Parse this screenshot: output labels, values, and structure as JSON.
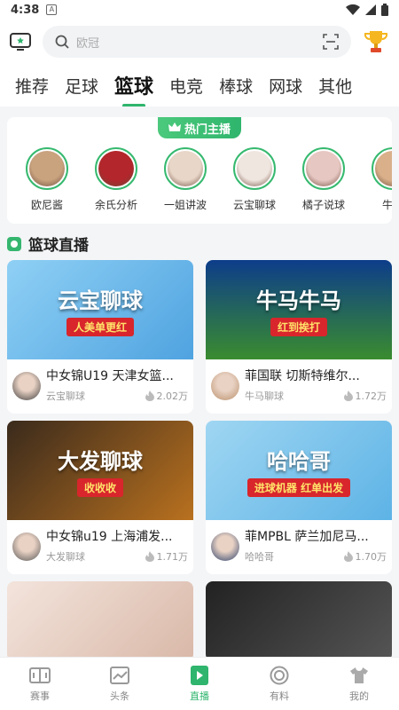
{
  "status": {
    "time": "4:38",
    "notif_letter": "A"
  },
  "search": {
    "placeholder": "欧冠"
  },
  "tabs": [
    {
      "label": "推荐"
    },
    {
      "label": "足球"
    },
    {
      "label": "篮球"
    },
    {
      "label": "电竞"
    },
    {
      "label": "棒球"
    },
    {
      "label": "网球"
    },
    {
      "label": "其他"
    }
  ],
  "active_tab": "篮球",
  "hot": {
    "badge": "热门主播",
    "anchors": [
      {
        "name": "欧尼酱",
        "color": "#c9a27e"
      },
      {
        "name": "余氏分析",
        "color": "#b3262b"
      },
      {
        "name": "一姐讲波",
        "color": "#e8d6c8"
      },
      {
        "name": "云宝聊球",
        "color": "#f0e6e0"
      },
      {
        "name": "橘子说球",
        "color": "#e7c7c2"
      },
      {
        "name": "牛马",
        "color": "#d9b08a"
      }
    ]
  },
  "section": {
    "title": "篮球直播"
  },
  "cards": [
    {
      "title": "中女锦U19 天津女篮...",
      "anchor": "云宝聊球",
      "heat": "2.02万",
      "thumb_text": "云宝聊球",
      "thumb_sub": "人美单更红",
      "bg": "linear-gradient(135deg,#8fd0f5,#4fa3e0)",
      "avatar": "#3b3b3b"
    },
    {
      "title": "菲国联 切斯特维尔...",
      "anchor": "牛马聊球",
      "heat": "1.72万",
      "thumb_text": "牛马牛马",
      "thumb_sub": "红到挨打",
      "bg": "linear-gradient(180deg,#0d3d8a,#3a8c2f)",
      "avatar": "#b9906a"
    },
    {
      "title": "中女锦u19 上海浦发...",
      "anchor": "大发聊球",
      "heat": "1.71万",
      "thumb_text": "大发聊球",
      "thumb_sub": "收收收",
      "bg": "linear-gradient(135deg,#3a2a1c,#b9711f)",
      "avatar": "#555555"
    },
    {
      "title": "菲MPBL 萨兰加尼马...",
      "anchor": "哈哈哥",
      "heat": "1.70万",
      "thumb_text": "哈哈哥",
      "thumb_sub": "进球机器 红单出发",
      "bg": "linear-gradient(135deg,#9fd6f2,#5db3e6)",
      "avatar": "#2a3f6a"
    }
  ],
  "nav": [
    {
      "label": "赛事",
      "icon": "scoreboard-icon"
    },
    {
      "label": "头条",
      "icon": "chart-icon"
    },
    {
      "label": "直播",
      "icon": "live-icon"
    },
    {
      "label": "有料",
      "icon": "coin-icon"
    },
    {
      "label": "我的",
      "icon": "jersey-icon"
    }
  ],
  "active_nav": "直播",
  "colors": {
    "accent": "#2fb56d"
  }
}
